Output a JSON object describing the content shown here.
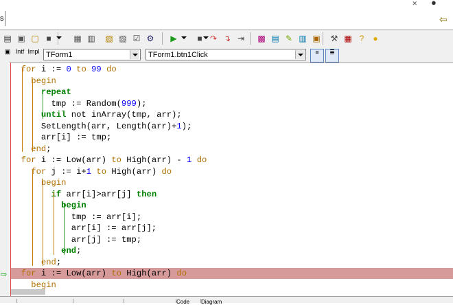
{
  "window": {
    "tab_stub": "s",
    "restore_glyph": "✕",
    "close_glyph": "●",
    "back_glyph": "⇦"
  },
  "toolbar": {
    "buttons": [
      {
        "icon": "new-unit-icon",
        "glyph": "▤"
      },
      {
        "icon": "new-form-icon",
        "glyph": "▣"
      },
      {
        "icon": "open-icon",
        "glyph": "▢"
      },
      {
        "icon": "save-icon",
        "glyph": "■"
      },
      {
        "icon": "save-all-icon",
        "glyph": "▦"
      },
      {
        "icon": "print-icon",
        "glyph": "▥"
      },
      {
        "icon": "open-project-icon",
        "glyph": "▧"
      },
      {
        "icon": "add-file-icon",
        "glyph": "▨"
      },
      {
        "icon": "remove-file-icon",
        "glyph": "☑"
      },
      {
        "icon": "toggle-form-unit-icon",
        "glyph": "⚙"
      },
      {
        "icon": "run-icon",
        "glyph": "▶"
      },
      {
        "icon": "pause-icon",
        "glyph": "■"
      },
      {
        "icon": "trace-into-icon",
        "glyph": "↷"
      },
      {
        "icon": "step-over-icon",
        "glyph": "↴"
      },
      {
        "icon": "run-to-cursor-icon",
        "glyph": "⇥"
      },
      {
        "icon": "component-icon",
        "glyph": "▩"
      },
      {
        "icon": "component-palette-icon",
        "glyph": "▤"
      },
      {
        "icon": "edit-icon",
        "glyph": "✎"
      },
      {
        "icon": "package-icon",
        "glyph": "▥"
      },
      {
        "icon": "database-icon",
        "glyph": "▣"
      },
      {
        "icon": "tools-icon",
        "glyph": "⚒"
      },
      {
        "icon": "book-icon",
        "glyph": "▦"
      },
      {
        "icon": "help-icon",
        "glyph": "?"
      },
      {
        "icon": "tip-icon",
        "glyph": "●"
      }
    ]
  },
  "selector_bar": {
    "intf_label": "Intf",
    "impl_label": "Impl",
    "class_combo": "TForm1",
    "method_combo": "TForm1.btn1Click"
  },
  "code_lines": [
    [
      {
        "t": "  ",
        "c": "txt"
      },
      {
        "t": "for",
        "c": "kw"
      },
      {
        "t": " i := ",
        "c": "txt"
      },
      {
        "t": "0",
        "c": "num"
      },
      {
        "t": " ",
        "c": "txt"
      },
      {
        "t": "to",
        "c": "kw"
      },
      {
        "t": " ",
        "c": "txt"
      },
      {
        "t": "99",
        "c": "num"
      },
      {
        "t": " ",
        "c": "txt"
      },
      {
        "t": "do",
        "c": "kw"
      }
    ],
    [
      {
        "t": "    ",
        "c": "txt"
      },
      {
        "t": "begin",
        "c": "kw"
      }
    ],
    [
      {
        "t": "      ",
        "c": "txt"
      },
      {
        "t": "repeat",
        "c": "kw2"
      }
    ],
    [
      {
        "t": "        tmp := Random(",
        "c": "txt"
      },
      {
        "t": "999",
        "c": "num"
      },
      {
        "t": ");",
        "c": "txt"
      }
    ],
    [
      {
        "t": "      ",
        "c": "txt"
      },
      {
        "t": "until",
        "c": "kw2"
      },
      {
        "t": " not inArray(tmp, arr);",
        "c": "txt"
      }
    ],
    [
      {
        "t": "      SetLength(arr, Length(arr)+",
        "c": "txt"
      },
      {
        "t": "1",
        "c": "num"
      },
      {
        "t": ");",
        "c": "txt"
      }
    ],
    [
      {
        "t": "      arr[i] := tmp;",
        "c": "txt"
      }
    ],
    [
      {
        "t": "    ",
        "c": "txt"
      },
      {
        "t": "end",
        "c": "kw"
      },
      {
        "t": ";",
        "c": "txt"
      }
    ],
    [
      {
        "t": "  ",
        "c": "txt"
      },
      {
        "t": "for",
        "c": "kw"
      },
      {
        "t": " i := Low(arr) ",
        "c": "txt"
      },
      {
        "t": "to",
        "c": "kw"
      },
      {
        "t": " High(arr) - ",
        "c": "txt"
      },
      {
        "t": "1",
        "c": "num"
      },
      {
        "t": " ",
        "c": "txt"
      },
      {
        "t": "do",
        "c": "kw"
      }
    ],
    [
      {
        "t": "    ",
        "c": "txt"
      },
      {
        "t": "for",
        "c": "kw"
      },
      {
        "t": " j := i+",
        "c": "txt"
      },
      {
        "t": "1",
        "c": "num"
      },
      {
        "t": " ",
        "c": "txt"
      },
      {
        "t": "to",
        "c": "kw"
      },
      {
        "t": " High(arr) ",
        "c": "txt"
      },
      {
        "t": "do",
        "c": "kw"
      }
    ],
    [
      {
        "t": "      ",
        "c": "txt"
      },
      {
        "t": "begin",
        "c": "kw"
      }
    ],
    [
      {
        "t": "        ",
        "c": "txt"
      },
      {
        "t": "if",
        "c": "kw2"
      },
      {
        "t": " arr[i]>arr[j] ",
        "c": "txt"
      },
      {
        "t": "then",
        "c": "kw2"
      }
    ],
    [
      {
        "t": "          ",
        "c": "txt"
      },
      {
        "t": "begin",
        "c": "kw2"
      }
    ],
    [
      {
        "t": "            tmp := arr[i];",
        "c": "txt"
      }
    ],
    [
      {
        "t": "            arr[i] := arr[j];",
        "c": "txt"
      }
    ],
    [
      {
        "t": "            arr[j] := tmp;",
        "c": "txt"
      }
    ],
    [
      {
        "t": "          ",
        "c": "txt"
      },
      {
        "t": "end",
        "c": "kw2"
      },
      {
        "t": ";",
        "c": "txt"
      }
    ],
    [
      {
        "t": "      ",
        "c": "txt"
      },
      {
        "t": "end",
        "c": "kw"
      },
      {
        "t": ";",
        "c": "txt"
      }
    ],
    [
      {
        "t": "  ",
        "c": "txt"
      },
      {
        "t": "for",
        "c": "kw"
      },
      {
        "t": " i := Low(arr) ",
        "c": "txt"
      },
      {
        "t": "to",
        "c": "kw"
      },
      {
        "t": " High(arr) ",
        "c": "txt"
      },
      {
        "t": "do",
        "c": "kw"
      }
    ],
    [
      {
        "t": "    ",
        "c": "txt"
      },
      {
        "t": "begin",
        "c": "kw"
      }
    ]
  ],
  "highlighted_line_index": 18,
  "colors": {
    "keyword": "#b07000",
    "keyword_inner": "#008000",
    "number": "#0000ff",
    "highlight": "#d69a9a",
    "margin": "#dd4444"
  },
  "status": {
    "panels": [
      "",
      "",
      "",
      "Code",
      "Diagram"
    ]
  }
}
